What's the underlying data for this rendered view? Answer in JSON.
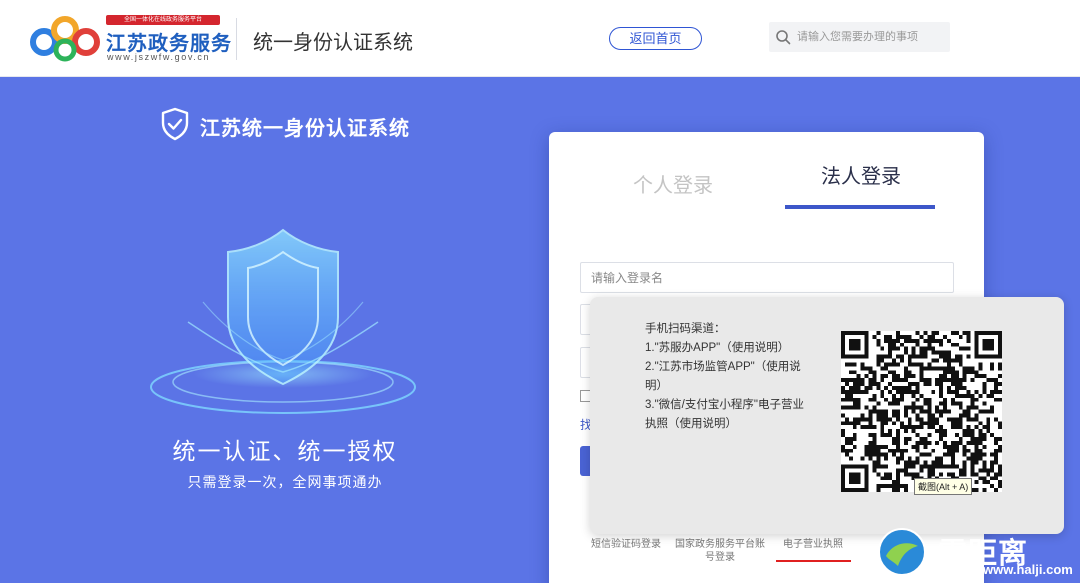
{
  "header": {
    "logo_slogan": "全国一体化在线政务服务平台",
    "logo_title": "江苏政务服务",
    "logo_domain": "www.jszwfw.gov.cn",
    "system_title": "统一身份认证系统",
    "home_button": "返回首页",
    "search_placeholder": "请输入您需要办理的事项"
  },
  "hero": {
    "title": "江苏统一身份认证系统",
    "slogan_main": "统一认证、统一授权",
    "slogan_sub": "只需登录一次，全网事项通办"
  },
  "login": {
    "tab_personal": "个人登录",
    "tab_legal": "法人登录",
    "active_tab": "法人登录",
    "username_placeholder": "请输入登录名",
    "find_link": "找",
    "alt_methods": [
      {
        "label": "短信验证码登录"
      },
      {
        "label": "国家政务服务平台账号登录"
      },
      {
        "label": "电子营业执照"
      }
    ]
  },
  "qr_popup": {
    "heading": "手机扫码渠道：",
    "lines": [
      "1.\"苏服办APP\"（使用说明）",
      "2.\"江苏市场监管APP\"（使用说明）",
      "3.\"微信/支付宝小程序\"电子营业执照（使用说明）"
    ],
    "tooltip": "截图(Alt + A)"
  },
  "watermark": {
    "text": "零距离",
    "url": "www.halji.com"
  },
  "colors": {
    "background": "#5b74e6",
    "primary": "#3d57c9",
    "brand_red": "#d4262e"
  }
}
